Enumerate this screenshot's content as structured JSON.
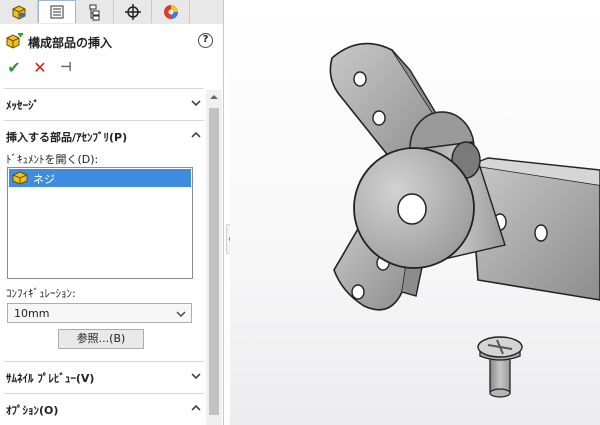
{
  "panel": {
    "tabs": [
      {
        "icon": "feature-manager-icon",
        "active": false
      },
      {
        "icon": "property-manager-icon",
        "active": true
      },
      {
        "icon": "configuration-manager-icon",
        "active": false
      },
      {
        "icon": "dimxpert-icon",
        "active": false
      },
      {
        "icon": "display-manager-icon",
        "active": false
      }
    ],
    "title": "構成部品の挿入",
    "help_label": "?",
    "actions": {
      "ok": "✔",
      "cancel": "✕",
      "pin": "⊣"
    },
    "sections": {
      "message": {
        "label": "ﾒｯｾｰｼﾞ",
        "collapsed": true
      },
      "insert": {
        "label": "挿入する部品/ｱｾﾝﾌﾞﾘ(P)",
        "collapsed": false
      },
      "thumbnail": {
        "label": "ｻﾑﾈｲﾙ ﾌﾟﾚﾋﾞｭｰ(V)",
        "collapsed": true
      },
      "options": {
        "label": "ｵﾌﾟｼｮﾝ(O)",
        "collapsed": false
      }
    },
    "open_documents_label": "ﾄﾞｷｭﾒﾝﾄを開く(D):",
    "documents": [
      {
        "name": "ネジ",
        "selected": true
      }
    ],
    "configuration_label": "ｺﾝﾌｨｷﾞｭﾚｰｼｮﾝ:",
    "configuration_value": "10mm",
    "browse_label": "参照...(B)"
  },
  "colors": {
    "selection": "#3d8ee0",
    "ok_green": "#2e9a2e",
    "cancel_red": "#d42020",
    "part_yellow": "#f0c020",
    "model_gray": "#a9a9a9"
  }
}
